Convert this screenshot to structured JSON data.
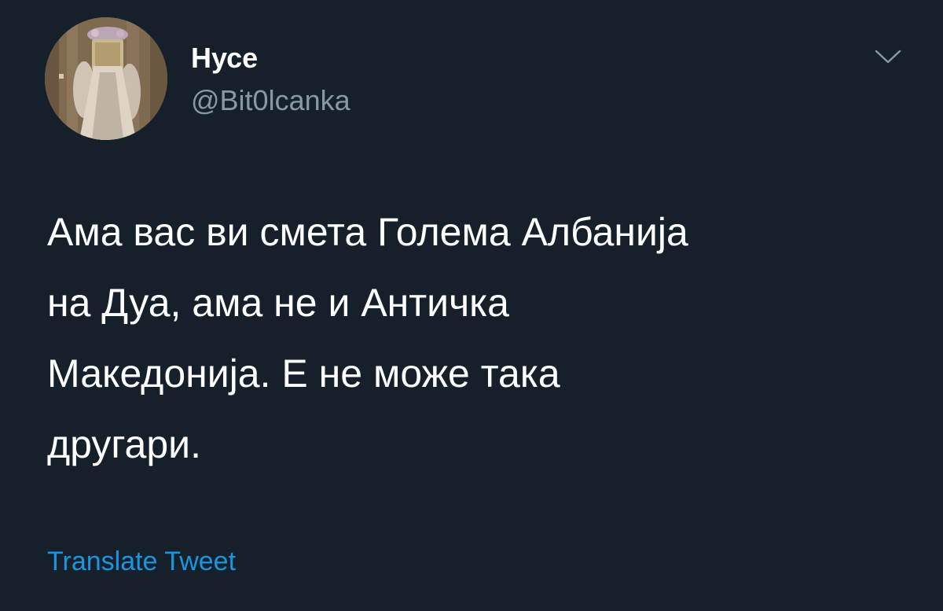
{
  "tweet": {
    "author": {
      "display_name": "Нусе",
      "handle": "@Bit0lcanka"
    },
    "text_lines": [
      "Ама вас ви смета Голема Албанија",
      "на Дуа, ама не и Античка",
      "Македонија. Е не може така",
      "другари."
    ],
    "translate_label": "Translate Tweet",
    "more_icon": "chevron-down-icon"
  },
  "colors": {
    "background": "#15202b",
    "primary_text": "#ffffff",
    "secondary_text": "#8899a6",
    "link": "#1b95e0"
  }
}
